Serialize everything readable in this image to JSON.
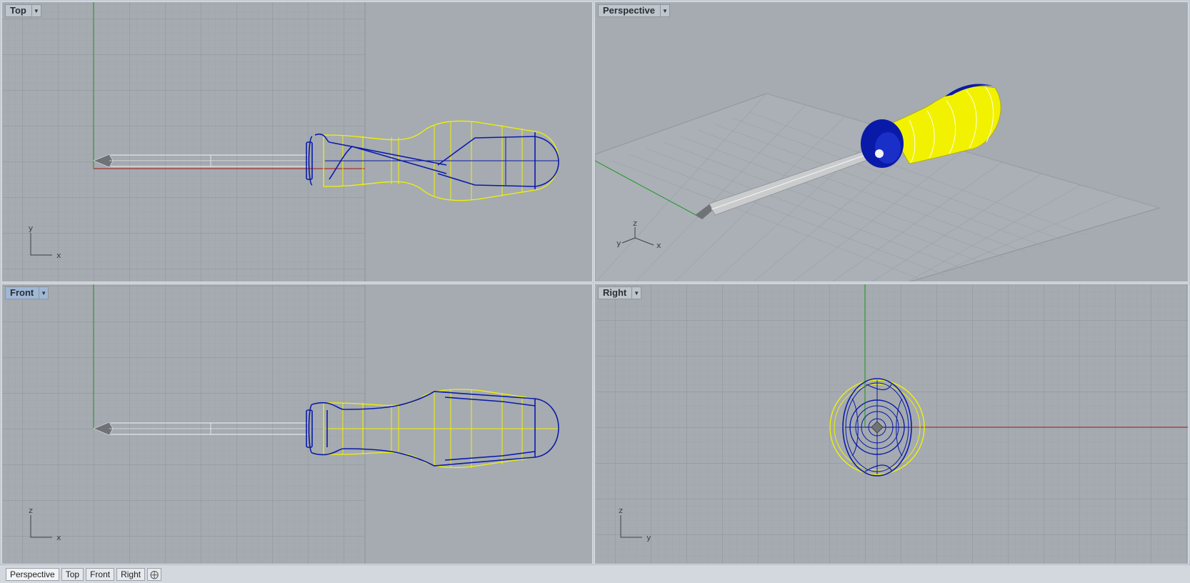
{
  "viewports": {
    "top": {
      "title": "Top",
      "axis_h": "x",
      "axis_v": "y"
    },
    "perspective": {
      "title": "Perspective",
      "axis_h": "x",
      "axis_v": "z",
      "axis_d": "y"
    },
    "front": {
      "title": "Front",
      "axis_h": "x",
      "axis_v": "z"
    },
    "right": {
      "title": "Right",
      "axis_h": "y",
      "axis_v": "z"
    }
  },
  "tabbar": {
    "tabs": [
      "Perspective",
      "Top",
      "Front",
      "Right"
    ],
    "add_icon": "add-viewport-icon"
  },
  "colors": {
    "viewport_bg": "#a5abb1",
    "grid_minor": "#98a0a7",
    "grid_major": "#8a9198",
    "x_axis": "#a83232",
    "y_axis": "#2f9a2f",
    "handle_yellow": "#f2f200",
    "handle_blue": "#0a1aa8",
    "active_viewport_title": "#9fb8d6"
  }
}
